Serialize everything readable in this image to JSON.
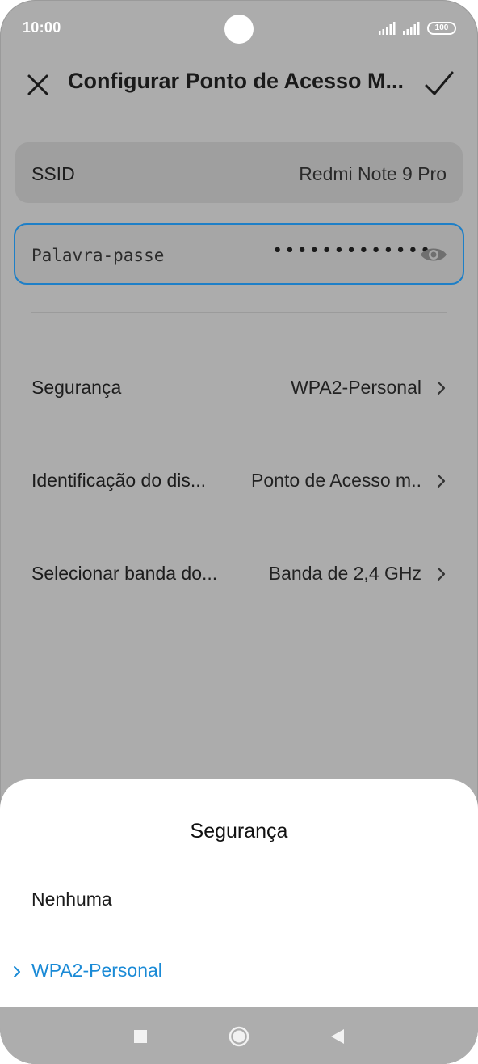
{
  "status_bar": {
    "time": "10:00",
    "battery": "100",
    "icons": [
      "signal-icon",
      "signal-icon",
      "battery-icon"
    ]
  },
  "header": {
    "title": "Configurar Ponto de Acesso M...",
    "close_icon": "close-icon",
    "confirm_icon": "check-icon"
  },
  "ssid": {
    "label": "SSID",
    "value": "Redmi Note 9 Pro"
  },
  "password": {
    "placeholder": "Palavra-passe",
    "masked_value": "•••••••••••••",
    "toggle_icon": "eye-icon"
  },
  "settings": [
    {
      "label": "Segurança",
      "value": "WPA2-Personal"
    },
    {
      "label": "Identificação do dis...",
      "value": "Ponto de Acesso m.."
    },
    {
      "label": "Selecionar banda do...",
      "value": "Banda de 2,4 GHz"
    }
  ],
  "sheet": {
    "title": "Segurança",
    "options": [
      {
        "label": "Nenhuma",
        "selected": false
      },
      {
        "label": "WPA2-Personal",
        "selected": true
      }
    ]
  },
  "navbar": {
    "icons": [
      "recents-square-icon",
      "home-circle-icon",
      "back-triangle-icon"
    ]
  },
  "colors": {
    "accent": "#1a8ad6",
    "focus_border": "#1e7fc7",
    "dim_background": "#acacac",
    "sheet_background": "#ffffff"
  }
}
